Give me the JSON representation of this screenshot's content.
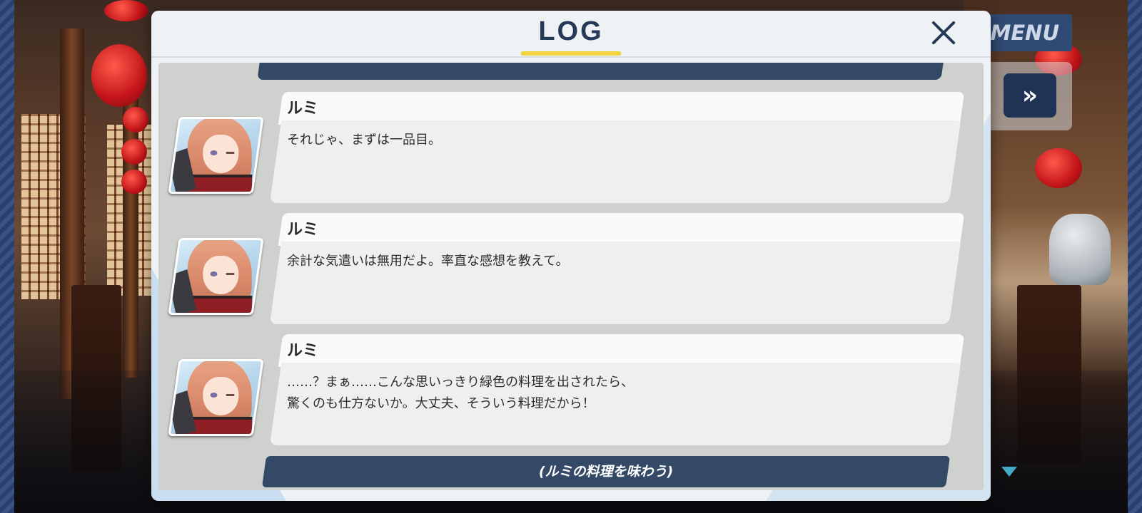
{
  "hud": {
    "menu_label": "MENU",
    "fast_forward_symbol": "»",
    "accent_color": "#44a9c4"
  },
  "log": {
    "title": "LOG",
    "close_symbol": "×",
    "entries": [
      {
        "speaker": "ルミ",
        "text": "それじゃ、まずは一品目。"
      },
      {
        "speaker": "ルミ",
        "text": "余計な気遣いは無用だよ。率直な感想を教えて。"
      },
      {
        "speaker": "ルミ",
        "text": "……？まぁ……こんな思いっきり緑色の料理を出されたら、\n驚くのも仕方ないか。大丈夫、そういう料理だから！"
      }
    ],
    "choice": "(ルミの料理を味わう)"
  },
  "colors": {
    "title_underline": "#f2d640",
    "navy": "#334966",
    "title_text": "#263a58"
  }
}
